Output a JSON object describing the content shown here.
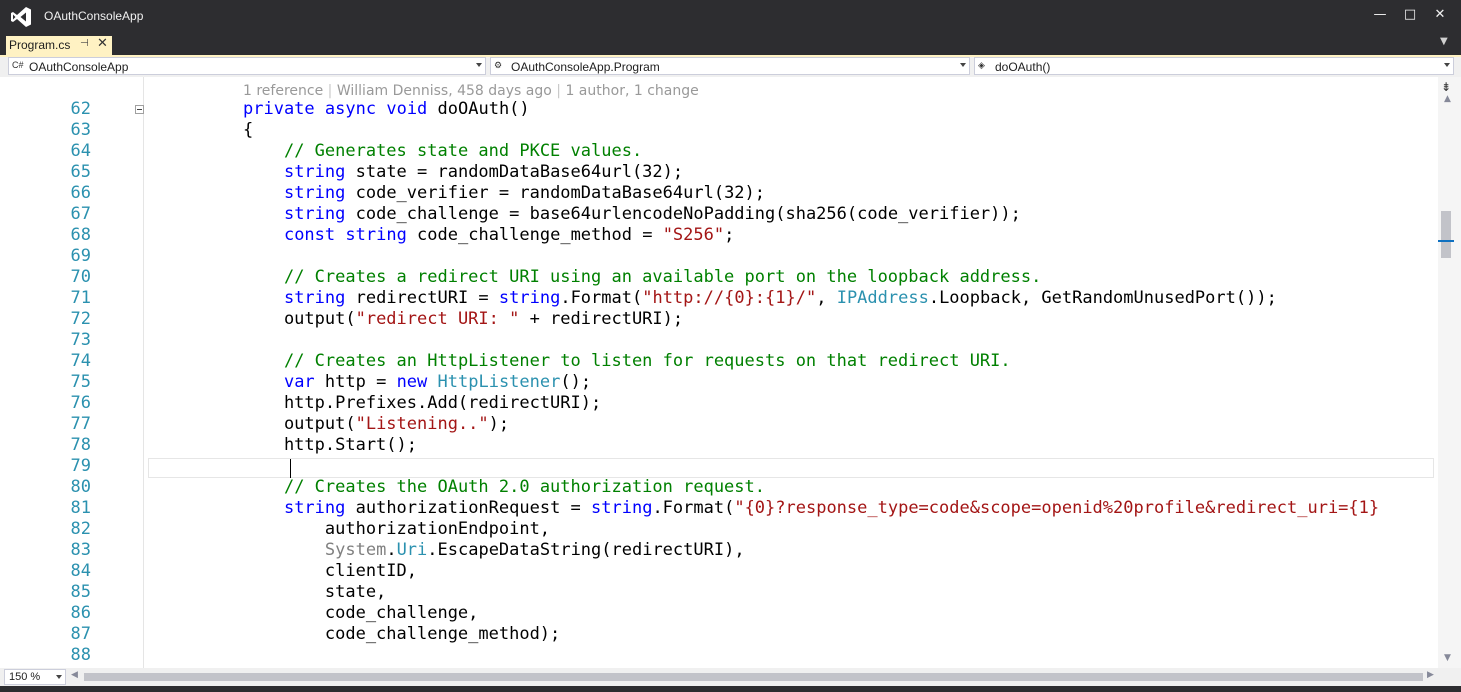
{
  "window": {
    "title": "OAuthConsoleApp",
    "minimize_glyph": "—",
    "maximize_glyph": "□",
    "close_glyph": "✕",
    "logo_icon": "visual-studio-logo"
  },
  "tabs": [
    {
      "label": "Program.cs",
      "pin_glyph": "⊣",
      "close_glyph": "✕",
      "active": true
    }
  ],
  "tab_overflow_glyph": "▼",
  "navbar": {
    "project": {
      "icon": "C#",
      "label": "OAuthConsoleApp"
    },
    "class": {
      "icon": "⚙",
      "label": "OAuthConsoleApp.Program"
    },
    "member": {
      "icon": "◈",
      "label": "doOAuth()"
    }
  },
  "codelens": {
    "references": "1 reference",
    "separator": "|",
    "author": "William Denniss, 458 days ago",
    "changes": "1 author, 1 change"
  },
  "code_lines": [
    {
      "n": "62",
      "tokens": [
        {
          "t": "private",
          "c": "kw"
        },
        {
          "t": " "
        },
        {
          "t": "async",
          "c": "kw"
        },
        {
          "t": " "
        },
        {
          "t": "void",
          "c": "kw"
        },
        {
          "t": " doOAuth()"
        }
      ]
    },
    {
      "n": "63",
      "tokens": [
        {
          "t": "{"
        }
      ]
    },
    {
      "n": "64",
      "tokens": [
        {
          "t": "    "
        },
        {
          "t": "// Generates state and PKCE values.",
          "c": "cm"
        }
      ]
    },
    {
      "n": "65",
      "tokens": [
        {
          "t": "    "
        },
        {
          "t": "string",
          "c": "kw"
        },
        {
          "t": " state = randomDataBase64url(32);"
        }
      ]
    },
    {
      "n": "66",
      "tokens": [
        {
          "t": "    "
        },
        {
          "t": "string",
          "c": "kw"
        },
        {
          "t": " code_verifier = randomDataBase64url(32);"
        }
      ]
    },
    {
      "n": "67",
      "tokens": [
        {
          "t": "    "
        },
        {
          "t": "string",
          "c": "kw"
        },
        {
          "t": " code_challenge = base64urlencodeNoPadding(sha256(code_verifier));"
        }
      ]
    },
    {
      "n": "68",
      "tokens": [
        {
          "t": "    "
        },
        {
          "t": "const",
          "c": "kw"
        },
        {
          "t": " "
        },
        {
          "t": "string",
          "c": "kw"
        },
        {
          "t": " code_challenge_method = "
        },
        {
          "t": "\"S256\"",
          "c": "st"
        },
        {
          "t": ";"
        }
      ]
    },
    {
      "n": "69",
      "tokens": []
    },
    {
      "n": "70",
      "tokens": [
        {
          "t": "    "
        },
        {
          "t": "// Creates a redirect URI using an available port on the loopback address.",
          "c": "cm"
        }
      ]
    },
    {
      "n": "71",
      "tokens": [
        {
          "t": "    "
        },
        {
          "t": "string",
          "c": "kw"
        },
        {
          "t": " redirectURI = "
        },
        {
          "t": "string",
          "c": "kw"
        },
        {
          "t": ".Format("
        },
        {
          "t": "\"http://{0}:{1}/\"",
          "c": "st"
        },
        {
          "t": ", "
        },
        {
          "t": "IPAddress",
          "c": "ty"
        },
        {
          "t": ".Loopback, GetRandomUnusedPort());"
        }
      ]
    },
    {
      "n": "72",
      "tokens": [
        {
          "t": "    output("
        },
        {
          "t": "\"redirect URI: \"",
          "c": "st"
        },
        {
          "t": " + redirectURI);"
        }
      ]
    },
    {
      "n": "73",
      "tokens": []
    },
    {
      "n": "74",
      "tokens": [
        {
          "t": "    "
        },
        {
          "t": "// Creates an HttpListener to listen for requests on that redirect URI.",
          "c": "cm"
        }
      ]
    },
    {
      "n": "75",
      "tokens": [
        {
          "t": "    "
        },
        {
          "t": "var",
          "c": "kw"
        },
        {
          "t": " http = "
        },
        {
          "t": "new",
          "c": "kw"
        },
        {
          "t": " "
        },
        {
          "t": "HttpListener",
          "c": "ty"
        },
        {
          "t": "();"
        }
      ]
    },
    {
      "n": "76",
      "tokens": [
        {
          "t": "    http.Prefixes.Add(redirectURI);"
        }
      ]
    },
    {
      "n": "77",
      "tokens": [
        {
          "t": "    output("
        },
        {
          "t": "\"Listening..\"",
          "c": "st"
        },
        {
          "t": ");"
        }
      ]
    },
    {
      "n": "78",
      "tokens": [
        {
          "t": "    http.Start();"
        }
      ]
    },
    {
      "n": "79",
      "tokens": []
    },
    {
      "n": "80",
      "tokens": [
        {
          "t": "    "
        },
        {
          "t": "// Creates the OAuth 2.0 authorization request.",
          "c": "cm"
        }
      ]
    },
    {
      "n": "81",
      "tokens": [
        {
          "t": "    "
        },
        {
          "t": "string",
          "c": "kw"
        },
        {
          "t": " authorizationRequest = "
        },
        {
          "t": "string",
          "c": "kw"
        },
        {
          "t": ".Format("
        },
        {
          "t": "\"{0}?response_type=code&scope=openid%20profile&redirect_uri={1}",
          "c": "st"
        }
      ]
    },
    {
      "n": "82",
      "tokens": [
        {
          "t": "        authorizationEndpoint,"
        }
      ]
    },
    {
      "n": "83",
      "tokens": [
        {
          "t": "        "
        },
        {
          "t": "System",
          "c": "gy"
        },
        {
          "t": "."
        },
        {
          "t": "Uri",
          "c": "ty"
        },
        {
          "t": ".EscapeDataString(redirectURI),"
        }
      ]
    },
    {
      "n": "84",
      "tokens": [
        {
          "t": "        clientID,"
        }
      ]
    },
    {
      "n": "85",
      "tokens": [
        {
          "t": "        state,"
        }
      ]
    },
    {
      "n": "86",
      "tokens": [
        {
          "t": "        code_challenge,"
        }
      ]
    },
    {
      "n": "87",
      "tokens": [
        {
          "t": "        code_challenge_method);"
        }
      ]
    },
    {
      "n": "88",
      "tokens": []
    }
  ],
  "zoom": {
    "label": "150 %"
  },
  "scroll": {
    "up_glyph": "▲",
    "down_glyph": "▼",
    "left_glyph": "◀",
    "right_glyph": "▶",
    "split_glyph": "⇟"
  },
  "colors": {
    "keyword": "#0000ff",
    "comment": "#008000",
    "string": "#a31515",
    "type": "#2b91af",
    "line_number": "#2b91af",
    "tab_active": "#fff2c3",
    "chrome": "#2d2d30"
  }
}
